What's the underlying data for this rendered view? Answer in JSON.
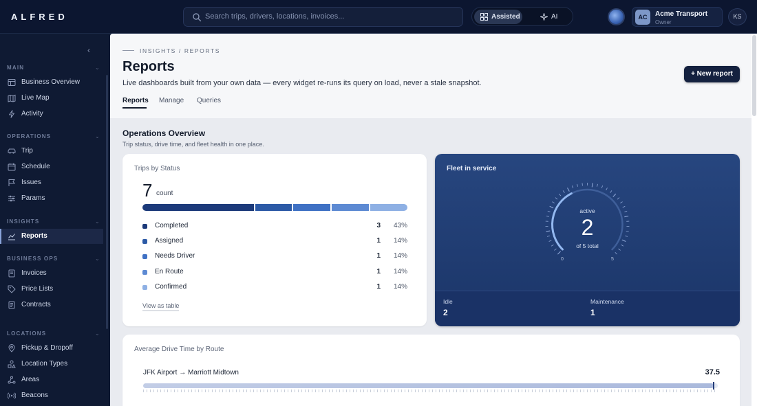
{
  "app": {
    "logo": "ALFRED"
  },
  "search": {
    "placeholder": "Search trips, drivers, locations, invoices..."
  },
  "modes": {
    "assisted": "Assisted",
    "ai": "AI"
  },
  "account": {
    "initials": "AC",
    "name": "Acme Transport",
    "role": "Owner",
    "user_initials": "KS"
  },
  "sidebar": {
    "sections": [
      {
        "label": "MAIN",
        "items": [
          "Business Overview",
          "Live Map",
          "Activity"
        ]
      },
      {
        "label": "OPERATIONS",
        "items": [
          "Trip",
          "Schedule",
          "Issues",
          "Params"
        ]
      },
      {
        "label": "INSIGHTS",
        "items": [
          "Reports"
        ]
      },
      {
        "label": "BUSINESS OPS",
        "items": [
          "Invoices",
          "Price Lists",
          "Contracts"
        ]
      },
      {
        "label": "LOCATIONS",
        "items": [
          "Pickup & Dropoff",
          "Location Types",
          "Areas",
          "Beacons"
        ]
      }
    ],
    "active": "Reports"
  },
  "header": {
    "breadcrumb": "INSIGHTS / REPORTS",
    "title": "Reports",
    "description": "Live dashboards built from your own data — every widget re-runs its query on load, never a stale snapshot.",
    "new_button": "+ New report",
    "tabs": [
      "Reports",
      "Manage",
      "Queries"
    ],
    "active_tab": "Reports"
  },
  "overview": {
    "title": "Operations Overview",
    "description": "Trip status, drive time, and fleet health in one place."
  },
  "trips_card": {
    "title": "Trips by Status",
    "total": "7",
    "unit": "count",
    "rows": [
      {
        "label": "Completed",
        "count": "3",
        "pct": "43%",
        "color": "#1c3a7a"
      },
      {
        "label": "Assigned",
        "count": "1",
        "pct": "14%",
        "color": "#2c5aa6"
      },
      {
        "label": "Needs Driver",
        "count": "1",
        "pct": "14%",
        "color": "#3f71c4"
      },
      {
        "label": "En Route",
        "count": "1",
        "pct": "14%",
        "color": "#5d8ad3"
      },
      {
        "label": "Confirmed",
        "count": "1",
        "pct": "14%",
        "color": "#8eb0e4"
      }
    ],
    "link": "View as table"
  },
  "fleet_card": {
    "title": "Fleet in service",
    "gauge_label": "active",
    "value": "2",
    "value_num": 2,
    "max_num": 5,
    "total_label": "of 5 total",
    "min_tick": "0",
    "max_tick": "5",
    "stats": [
      {
        "label": "Idle",
        "value": "2"
      },
      {
        "label": "Maintenance",
        "value": "1"
      }
    ]
  },
  "drive_card": {
    "title": "Average Drive Time by Route",
    "routes": [
      {
        "label": "JFK Airport → Marriott Midtown",
        "value": "37.5",
        "fraction": 0.993
      }
    ]
  }
}
